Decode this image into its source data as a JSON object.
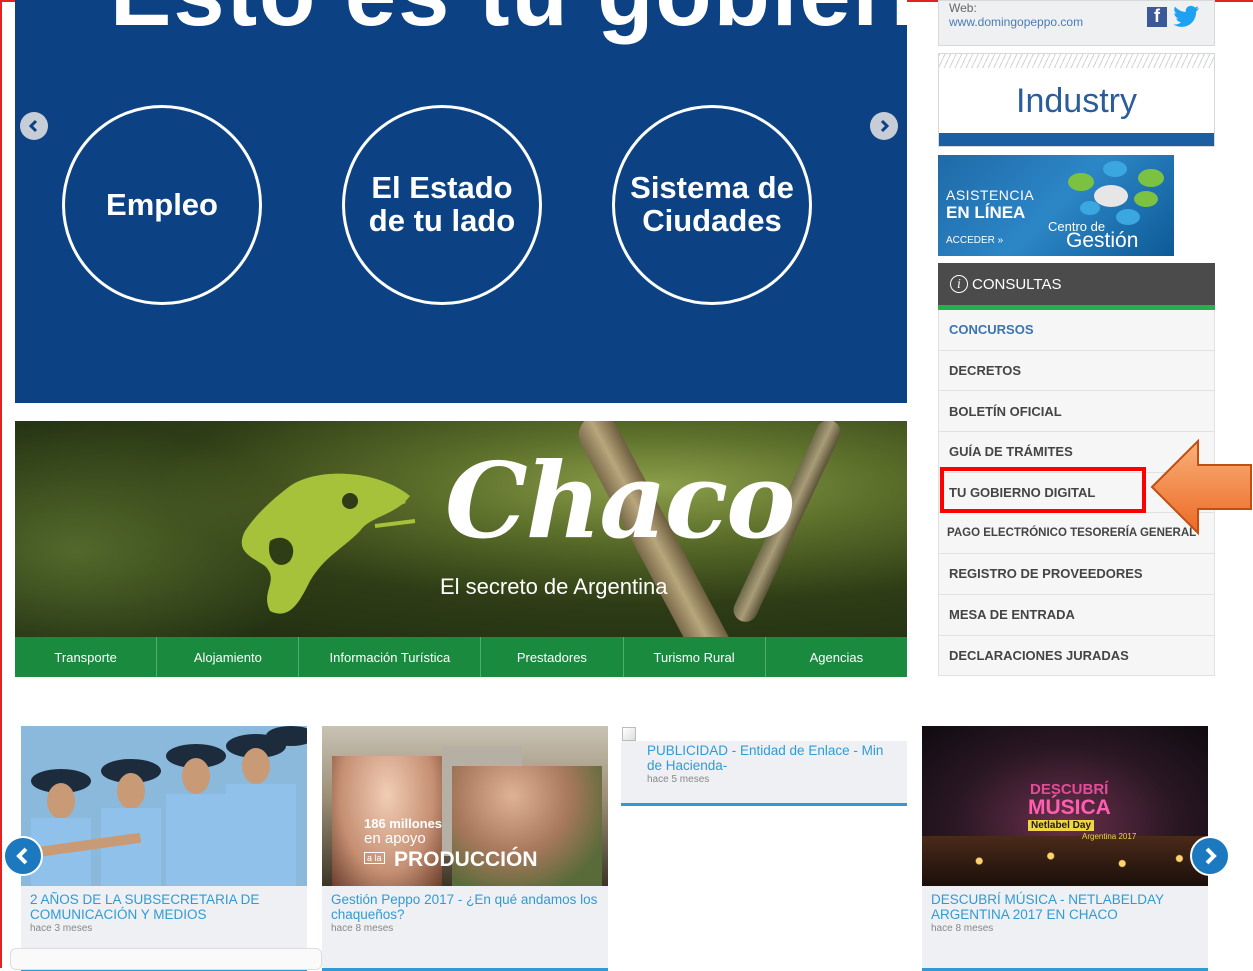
{
  "hero": {
    "title": "Esto es tu gobierno",
    "circles": [
      "Empleo",
      "El Estado\nde tu lado",
      "Sistema de\nCiudades"
    ]
  },
  "chaco": {
    "logo_word": "Chaco",
    "tagline": "El secreto de Argentina"
  },
  "green_nav": [
    "Transporte",
    "Alojamiento",
    "Información Turística",
    "Prestadores",
    "Turismo Rural",
    "Agencias"
  ],
  "sidebar": {
    "web_label": "Web:",
    "web_url": "www.domingopeppo.com",
    "industry": "Industry",
    "asistencia": {
      "line1": "ASISTENCIA",
      "line2": "EN LÍNEA",
      "line3": "ACCEDER »",
      "line4": "Centro de",
      "line5": "Gestión"
    },
    "consultas_label": "CONSULTAS",
    "menu": [
      "CONCURSOS",
      "DECRETOS",
      "BOLETÍN OFICIAL",
      "GUÍA DE TRÁMITES",
      "TU GOBIERNO DIGITAL",
      "PAGO ELECTRÓNICO TESORERÍA GENERAL",
      "REGISTRO DE PROVEEDORES",
      "MESA DE ENTRADA",
      "DECLARACIONES JURADAS"
    ]
  },
  "news": [
    {
      "title": "2 AÑOS DE LA SUBSECRETARIA DE COMUNICACIÓN Y MEDIOS",
      "meta": "hace 3 meses"
    },
    {
      "title": "Gestión Peppo 2017 - ¿En qué andamos los chaqueños?",
      "meta": "hace 8 meses",
      "img_text1": "186 millones",
      "img_text2": "en apoyo",
      "img_text3": "a la",
      "img_text4": "PRODUCCIÓN"
    },
    {
      "title": "PUBLICIDAD - Entidad de Enlace - Min de Hacienda-",
      "meta": "hace 5 meses"
    },
    {
      "title": "DESCUBRÍ MÚSICA - NETLABELDAY ARGENTINA 2017 EN CHACO",
      "meta": "hace 8 meses",
      "img_text1": "DESCUBRÍ",
      "img_text2": "MÚSICA",
      "img_text3": "Netlabel Day",
      "img_text4": "Argentina 2017"
    }
  ],
  "colors": {
    "hero_blue": "#0c4283",
    "nav_green": "#1a8a3e",
    "accent_blue": "#2f9bd6",
    "highlight_red": "#ff0000",
    "arrow_orange": "#f47a3a"
  }
}
